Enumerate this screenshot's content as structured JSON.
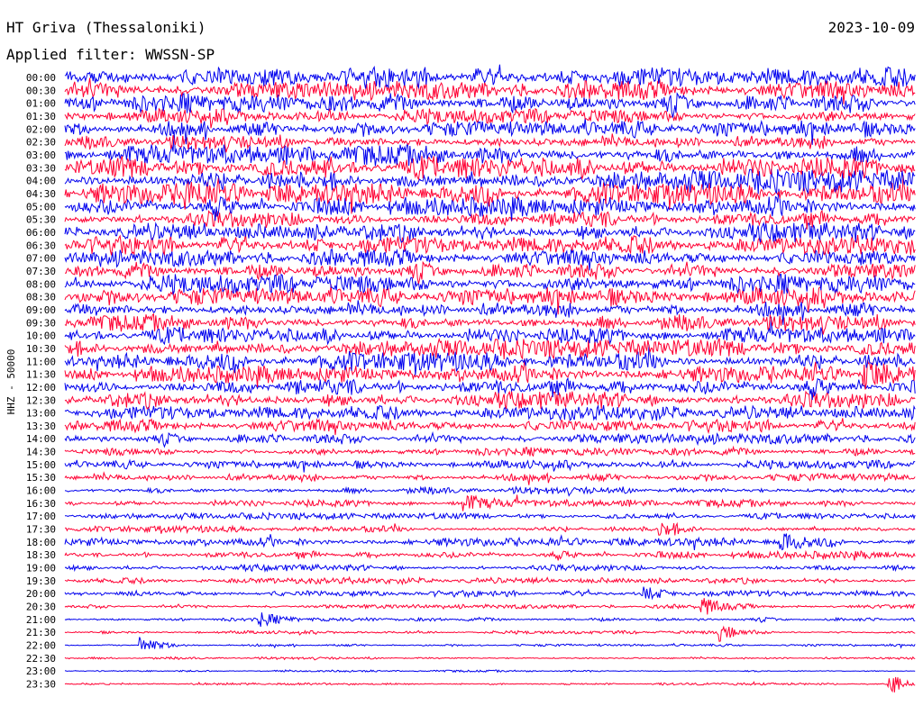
{
  "header": {
    "station": "HT Griva (Thessaloniki)",
    "date": "2023-10-09",
    "filter": "Applied filter: WWSSN-SP"
  },
  "chart_data": {
    "type": "line",
    "title": "HT Griva (Thessaloniki)",
    "date": "2023-10-09",
    "ylabel": "HHZ - 50000",
    "colors": [
      "#0000ee",
      "#ff0033"
    ],
    "row_labels": [
      "00:00",
      "00:30",
      "01:00",
      "01:30",
      "02:00",
      "02:30",
      "03:00",
      "03:30",
      "04:00",
      "04:30",
      "05:00",
      "05:30",
      "06:00",
      "06:30",
      "07:00",
      "07:30",
      "08:00",
      "08:30",
      "09:00",
      "09:30",
      "10:00",
      "10:30",
      "11:00",
      "11:30",
      "12:00",
      "12:30",
      "13:00",
      "13:30",
      "14:00",
      "14:30",
      "15:00",
      "15:30",
      "16:00",
      "16:30",
      "17:00",
      "17:30",
      "18:00",
      "18:30",
      "19:00",
      "19:30",
      "20:00",
      "20:30",
      "21:00",
      "21:30",
      "22:00",
      "22:30",
      "23:00",
      "23:30"
    ],
    "row_amplitude": [
      10,
      9,
      9,
      7,
      8,
      7,
      10,
      11,
      11,
      10,
      9,
      8,
      9,
      9,
      8,
      8,
      9,
      9,
      8,
      8,
      8,
      9,
      9,
      8,
      8,
      8,
      7,
      6,
      5,
      4,
      4,
      4,
      3.5,
      3.5,
      3,
      3,
      4,
      3.5,
      3,
      3,
      3,
      2,
      1.8,
      1.5,
      1.2,
      1.2,
      1,
      1
    ],
    "events": [
      {
        "row": 9,
        "x_frac": 0.14,
        "amp": 14
      },
      {
        "row": 23,
        "x_frac": 0.94,
        "amp": 12
      },
      {
        "row": 33,
        "x_frac": 0.47,
        "amp": 9
      },
      {
        "row": 35,
        "x_frac": 0.7,
        "amp": 10
      },
      {
        "row": 36,
        "x_frac": 0.84,
        "amp": 12
      },
      {
        "row": 40,
        "x_frac": 0.68,
        "amp": 7
      },
      {
        "row": 41,
        "x_frac": 0.75,
        "amp": 9
      },
      {
        "row": 42,
        "x_frac": 0.23,
        "amp": 7
      },
      {
        "row": 43,
        "x_frac": 0.77,
        "amp": 9
      },
      {
        "row": 44,
        "x_frac": 0.09,
        "amp": 10
      },
      {
        "row": 47,
        "x_frac": 0.97,
        "amp": 12
      }
    ]
  }
}
